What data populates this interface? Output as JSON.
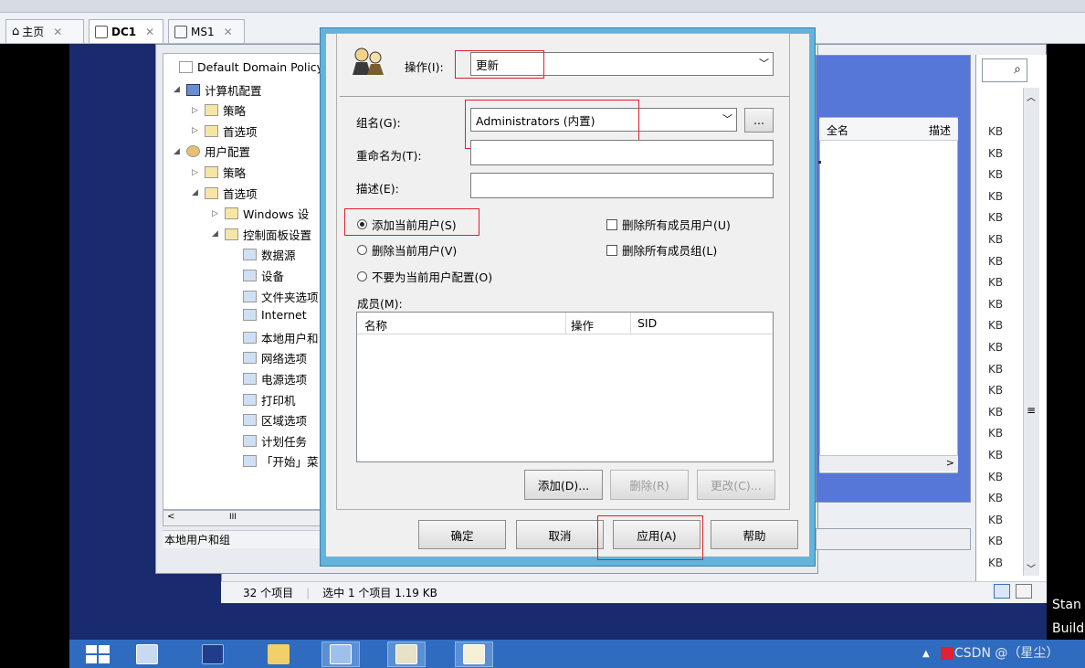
{
  "tabs": [
    {
      "label": "主页",
      "active": false
    },
    {
      "label": "DC1",
      "active": true
    },
    {
      "label": "MS1",
      "active": false
    }
  ],
  "tree": {
    "items": [
      {
        "label": "Default Domain Policy",
        "level": 0,
        "arrow": ""
      },
      {
        "label": "计算机配置",
        "level": 1,
        "arrow": "◢"
      },
      {
        "label": "策略",
        "level": 2,
        "arrow": "▷"
      },
      {
        "label": "首选项",
        "level": 2,
        "arrow": "▷"
      },
      {
        "label": "用户配置",
        "level": 1,
        "arrow": "◢"
      },
      {
        "label": "策略",
        "level": 2,
        "arrow": "▷"
      },
      {
        "label": "首选项",
        "level": 2,
        "arrow": "◢"
      },
      {
        "label": "Windows 设",
        "level": 3,
        "arrow": "▷"
      },
      {
        "label": "控制面板设置",
        "level": 3,
        "arrow": "◢"
      },
      {
        "label": "数据源",
        "level": 4,
        "arrow": ""
      },
      {
        "label": "设备",
        "level": 4,
        "arrow": ""
      },
      {
        "label": "文件夹选项",
        "level": 4,
        "arrow": ""
      },
      {
        "label": "Internet",
        "level": 4,
        "arrow": ""
      },
      {
        "label": "本地用户和",
        "level": 4,
        "arrow": ""
      },
      {
        "label": "网络选项",
        "level": 4,
        "arrow": ""
      },
      {
        "label": "电源选项",
        "level": 4,
        "arrow": ""
      },
      {
        "label": "打印机",
        "level": 4,
        "arrow": ""
      },
      {
        "label": "区域选项",
        "level": 4,
        "arrow": ""
      },
      {
        "label": "计划任务",
        "level": 4,
        "arrow": ""
      },
      {
        "label": "「开始」菜",
        "level": 4,
        "arrow": ""
      }
    ],
    "scroll_thumb": "III",
    "status": "本地用户和组"
  },
  "middle": {
    "col_fullname": "全名",
    "col_desc": "描述"
  },
  "explorer": {
    "status_count": "32 个项目",
    "status_selected": "选中 1 个项目 1.19 KB",
    "kb_label": "KB",
    "search_glyph": "⌕"
  },
  "dialog": {
    "action_label": "操作(I):",
    "action_value": "更新",
    "group_label": "组名(G):",
    "group_value": "Administrators (内置)",
    "browse_label": "...",
    "rename_label": "重命名为(T):",
    "rename_value": "",
    "desc_label": "描述(E):",
    "desc_value": "",
    "radio_add": "添加当前用户(S)",
    "radio_remove": "删除当前用户(V)",
    "radio_none": "不要为当前用户配置(O)",
    "chk_del_users": "删除所有成员用户(U)",
    "chk_del_groups": "删除所有成员组(L)",
    "members_label": "成员(M):",
    "col_name": "名称",
    "col_action": "操作",
    "col_sid": "SID",
    "btn_add": "添加(D)...",
    "btn_remove": "删除(R)",
    "btn_change": "更改(C)...",
    "btn_ok": "确定",
    "btn_cancel": "取消",
    "btn_apply": "应用(A)",
    "btn_help": "帮助"
  },
  "side_text": {
    "line1": "Stan",
    "line2": "Build "
  },
  "watermark": "CSDN @（星尘）",
  "colors": {
    "highlight_red": "#e0202b",
    "taskbar": "#2f6bbf",
    "desktop": "#1a2a6e"
  }
}
